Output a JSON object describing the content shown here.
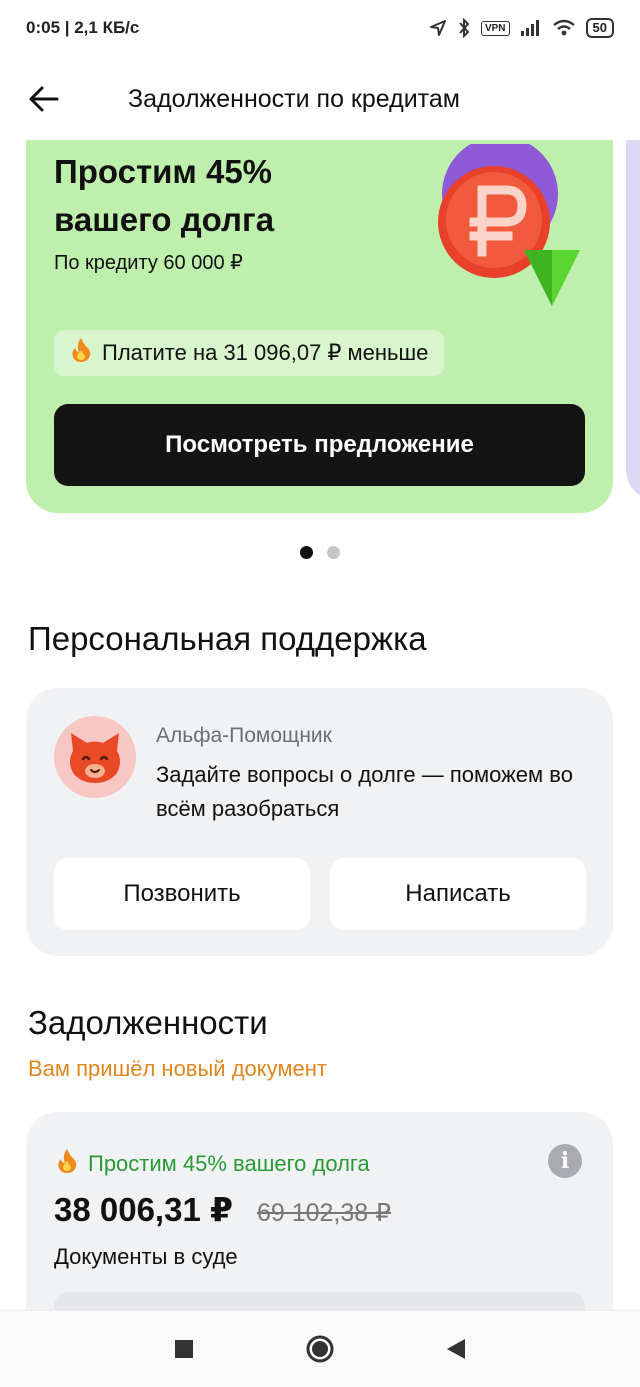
{
  "status_bar": {
    "time_speed": "0:05 | 2,1 КБ/с",
    "vpn": "VPN",
    "battery": "50"
  },
  "header": {
    "title": "Задолженности по кредитам"
  },
  "promo": {
    "title": "Простим 45% вашего долга",
    "subtitle": "По кредиту 60 000 ₽",
    "savings": "Платите на 31 096,07 ₽ меньше",
    "cta_label": "Посмотреть предложение",
    "slides_total": 2,
    "active_slide": 1
  },
  "support": {
    "section_title": "Персональная поддержка",
    "assistant_name": "Альфа-Помощник",
    "assistant_message": "Задайте вопросы о долге — поможем во всём разобраться",
    "call_label": "Позвонить",
    "write_label": "Написать"
  },
  "debts": {
    "section_title": "Задолженности",
    "notice": "Вам пришёл новый документ",
    "card": {
      "forgive_text": "Простим 45% вашего долга",
      "amount_new": "38 006,31 ₽",
      "amount_old": "69 102,38 ₽",
      "status": "Документы в суде"
    }
  },
  "colors": {
    "promo_bg": "#bfefad",
    "cta_bg": "#141414",
    "notice": "#e0861e",
    "forgive_green": "#2a9a36",
    "card_bg": "#f1f2f4"
  }
}
